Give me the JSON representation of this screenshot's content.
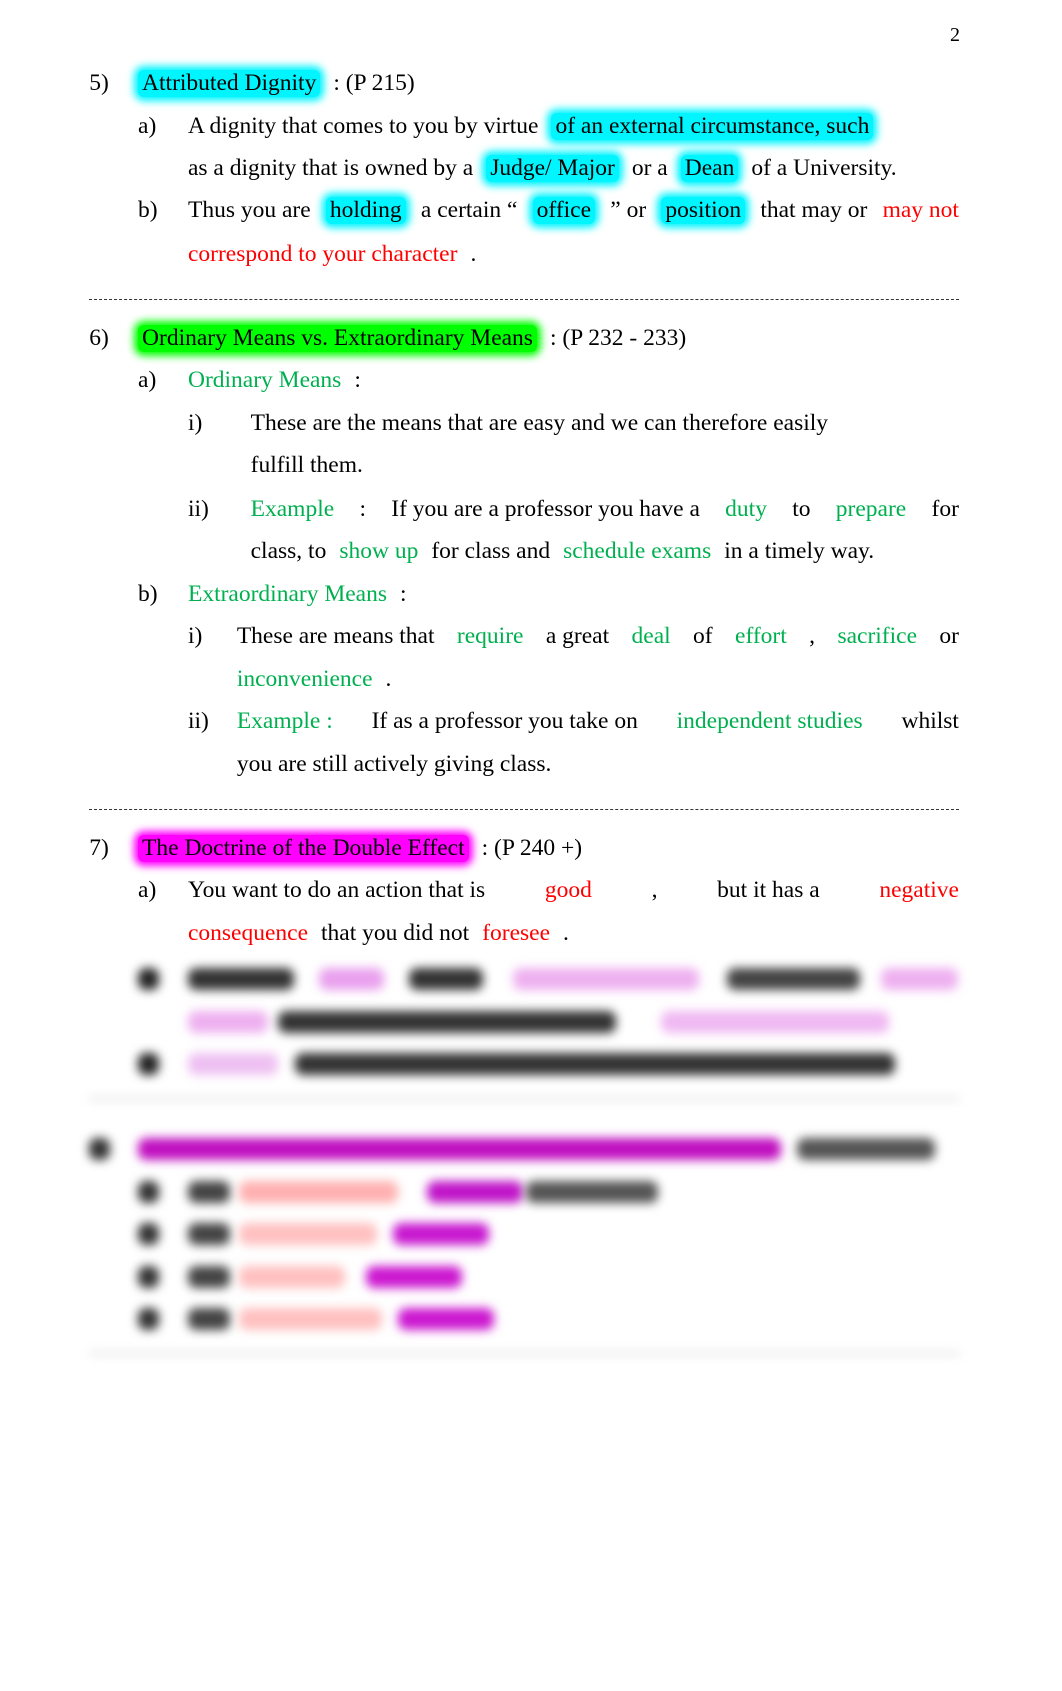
{
  "page_number": "2",
  "colors": {
    "cyan_highlight": "#00f5ff",
    "green_highlight": "#00ff00",
    "magenta_highlight": "#ff00ff",
    "red_text": "#ff0000",
    "green_text": "#00b050"
  },
  "lines": [
    {
      "label": "5)",
      "segs": [
        {
          "t": "Attributed Dignity",
          "hl": "cyan"
        },
        {
          "t": " : (P 215)"
        }
      ]
    },
    {
      "label": "a)",
      "segs": [
        {
          "t": "A dignity that comes to you by virtue"
        },
        {
          "t": "of an external circumstance, such",
          "hl": "cyan"
        }
      ]
    },
    {
      "label": "",
      "segs": [
        {
          "t": "as a dignity that is owned by a"
        },
        {
          "t": "Judge/ Major",
          "hl": "cyan"
        },
        {
          "t": "or a"
        },
        {
          "t": "Dean",
          "hl": "cyan"
        },
        {
          "t": "of a University."
        }
      ]
    },
    {
      "label": "b)",
      "segs": [
        {
          "t": "Thus you are"
        },
        {
          "t": "holding",
          "hl": "cyan"
        },
        {
          "t": "a certain “"
        },
        {
          "t": "office",
          "hl": "cyan"
        },
        {
          "t": "” or"
        },
        {
          "t": "position",
          "hl": "cyan"
        },
        {
          "t": "that may or"
        },
        {
          "t": "may not",
          "c": "red"
        }
      ]
    },
    {
      "label": "",
      "segs": [
        {
          "t": "correspond to your character",
          "c": "red"
        },
        {
          "t": "."
        }
      ]
    },
    {
      "label": "6)",
      "segs": [
        {
          "t": "Ordinary Means vs. Extraordinary Means",
          "hl": "green"
        },
        {
          "t": ": (P 232 - 233)"
        }
      ]
    },
    {
      "label": "a)",
      "segs": [
        {
          "t": "Ordinary Means",
          "c": "green"
        },
        {
          "t": ":"
        }
      ]
    },
    {
      "label": "i)",
      "segs": [
        {
          "t": "These are the means that are easy and we can therefore easily"
        }
      ]
    },
    {
      "label": "",
      "segs": [
        {
          "t": "fulfill them."
        }
      ]
    },
    {
      "label": "ii)",
      "segs": [
        {
          "t": "Example",
          "c": "green"
        },
        {
          "t": ":"
        },
        {
          "t": "If you are a professor you have a"
        },
        {
          "t": "duty",
          "c": "green"
        },
        {
          "t": "to"
        },
        {
          "t": "prepare",
          "c": "green"
        },
        {
          "t": "for"
        }
      ]
    },
    {
      "label": "",
      "segs": [
        {
          "t": "class, to"
        },
        {
          "t": "show up",
          "c": "green"
        },
        {
          "t": "for class and"
        },
        {
          "t": "schedule exams",
          "c": "green"
        },
        {
          "t": "in a timely way."
        }
      ]
    },
    {
      "label": "b)",
      "segs": [
        {
          "t": "Extraordinary Means",
          "c": "green"
        },
        {
          "t": ":"
        }
      ]
    },
    {
      "label": "i)",
      "segs": [
        {
          "t": "These are means that"
        },
        {
          "t": "require",
          "c": "green"
        },
        {
          "t": "a great"
        },
        {
          "t": "deal",
          "c": "green"
        },
        {
          "t": "of"
        },
        {
          "t": "effort",
          "c": "green"
        },
        {
          "t": ","
        },
        {
          "t": "sacrifice",
          "c": "green"
        },
        {
          "t": "or"
        }
      ]
    },
    {
      "label": "",
      "segs": [
        {
          "t": "inconvenience",
          "c": "green"
        },
        {
          "t": "."
        }
      ]
    },
    {
      "label": "ii)",
      "segs": [
        {
          "t": "Example :",
          "c": "green"
        },
        {
          "t": "If as a professor you take on"
        },
        {
          "t": "independent studies",
          "c": "green"
        },
        {
          "t": "whilst"
        }
      ]
    },
    {
      "label": "",
      "segs": [
        {
          "t": "you are still actively giving class."
        }
      ]
    },
    {
      "label": "7)",
      "segs": [
        {
          "t": "The Doctrine of the Double Effect",
          "hl": "magenta"
        },
        {
          "t": ": (P 240 +)"
        }
      ]
    },
    {
      "label": "a)",
      "segs": [
        {
          "t": "You want to do an action that is"
        },
        {
          "t": "good",
          "c": "red"
        },
        {
          "t": ","
        },
        {
          "t": "but it has a"
        },
        {
          "t": "negative",
          "c": "red"
        }
      ]
    },
    {
      "label": "",
      "segs": [
        {
          "t": "consequence",
          "c": "red"
        },
        {
          "t": "that you did not"
        },
        {
          "t": "foresee",
          "c": "red"
        },
        {
          "t": "."
        }
      ]
    }
  ]
}
